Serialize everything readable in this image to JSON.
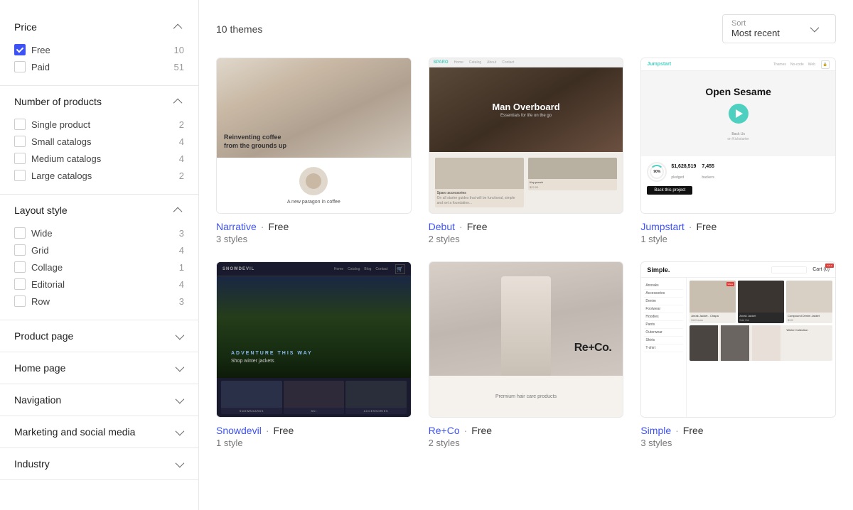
{
  "sidebar": {
    "sections": [
      {
        "id": "price",
        "title": "Price",
        "expanded": true,
        "options": [
          {
            "label": "Free",
            "count": 10,
            "checked": true
          },
          {
            "label": "Paid",
            "count": 51,
            "checked": false
          }
        ]
      },
      {
        "id": "number-of-products",
        "title": "Number of products",
        "expanded": true,
        "options": [
          {
            "label": "Single product",
            "count": 2,
            "checked": false
          },
          {
            "label": "Small catalogs",
            "count": 4,
            "checked": false
          },
          {
            "label": "Medium catalogs",
            "count": 4,
            "checked": false
          },
          {
            "label": "Large catalogs",
            "count": 2,
            "checked": false
          }
        ]
      },
      {
        "id": "layout-style",
        "title": "Layout style",
        "expanded": true,
        "options": [
          {
            "label": "Wide",
            "count": 3,
            "checked": false
          },
          {
            "label": "Grid",
            "count": 4,
            "checked": false
          },
          {
            "label": "Collage",
            "count": 1,
            "checked": false
          },
          {
            "label": "Editorial",
            "count": 4,
            "checked": false
          },
          {
            "label": "Row",
            "count": 3,
            "checked": false
          }
        ]
      },
      {
        "id": "product-page",
        "title": "Product page",
        "expanded": false,
        "options": []
      },
      {
        "id": "home-page",
        "title": "Home page",
        "expanded": false,
        "options": []
      },
      {
        "id": "navigation",
        "title": "Navigation",
        "expanded": false,
        "options": []
      },
      {
        "id": "marketing-social",
        "title": "Marketing and social media",
        "expanded": false,
        "options": []
      },
      {
        "id": "industry",
        "title": "Industry",
        "expanded": false,
        "options": []
      }
    ]
  },
  "main": {
    "themes_count_label": "10 themes",
    "sort": {
      "label": "Sort",
      "value": "Most recent"
    },
    "themes": [
      {
        "id": "narrative",
        "name": "Narrative",
        "price": "Free",
        "styles": "3 styles",
        "type": "narrative"
      },
      {
        "id": "debut",
        "name": "Debut",
        "price": "Free",
        "styles": "2 styles",
        "type": "debut"
      },
      {
        "id": "jumpstart",
        "name": "Jumpstart",
        "price": "Free",
        "styles": "1 style",
        "type": "jumpstart"
      },
      {
        "id": "snowdevil",
        "name": "Snowdevil",
        "price": "Free",
        "styles": "1 style",
        "type": "snowdevil"
      },
      {
        "id": "reco",
        "name": "Re+Co",
        "price": "Free",
        "styles": "2 styles",
        "type": "reco"
      },
      {
        "id": "simple",
        "name": "Simple",
        "price": "Free",
        "styles": "3 styles",
        "type": "simple"
      }
    ]
  },
  "icons": {
    "chevron_up": "▲",
    "chevron_down": "▼"
  }
}
